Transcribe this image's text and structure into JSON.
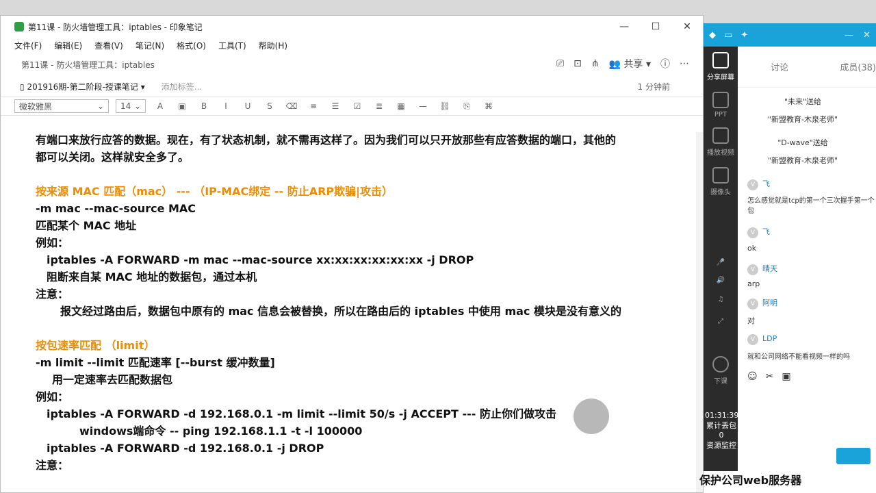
{
  "window": {
    "title": "第11课 - 防火墙管理工具：iptables - 印象笔记",
    "controls": {
      "minimize": "—",
      "maximize": "☐",
      "close": "✕"
    }
  },
  "menu": [
    "文件(F)",
    "编辑(E)",
    "查看(V)",
    "笔记(N)",
    "格式(O)",
    "工具(T)",
    "帮助(H)"
  ],
  "note": {
    "title": "第11课 - 防火墙管理工具：iptables",
    "share_label": "共享",
    "notebook": "201916期-第二阶段-授课笔记",
    "tag_placeholder": "添加标签...",
    "updated": "1 分钟前"
  },
  "toolbar": {
    "font": "微软雅黑",
    "size": "14"
  },
  "content": [
    {
      "text": "有端口来放行应答的数据。现在，有了状态机制，就不需再这样了。因为我们可以只开放那些有应答数据的端口，其他的",
      "cls": ""
    },
    {
      "text": "都可以关闭。这样就安全多了。",
      "cls": ""
    },
    {
      "text": "",
      "cls": ""
    },
    {
      "text": "按来源 MAC 匹配（mac）  ---  （IP-MAC绑定 -- 防止ARP欺骗|攻击）",
      "cls": "orange"
    },
    {
      "text": "-m mac --mac-source MAC",
      "cls": ""
    },
    {
      "text": "匹配某个 MAC 地址",
      "cls": ""
    },
    {
      "text": "例如：",
      "cls": ""
    },
    {
      "text": "iptables -A FORWARD -m mac --mac-source xx:xx:xx:xx:xx:xx -j DROP",
      "cls": "ind1"
    },
    {
      "text": "阻断来自某 MAC 地址的数据包，通过本机",
      "cls": "ind1"
    },
    {
      "text": "注意：",
      "cls": ""
    },
    {
      "text": "报文经过路由后，数据包中原有的 mac 信息会被替换，所以在路由后的 iptables 中使用 mac 模块是没有意义的",
      "cls": "ind3"
    },
    {
      "text": "",
      "cls": ""
    },
    {
      "text": "按包速率匹配    （limit）",
      "cls": "orange"
    },
    {
      "text": "-m limit --limit 匹配速率 [--burst 缓冲数量]",
      "cls": ""
    },
    {
      "text": "用一定速率去匹配数据包",
      "cls": "ind2"
    },
    {
      "text": "例如：",
      "cls": ""
    },
    {
      "text": "iptables -A FORWARD -d 192.168.0.1 -m limit --limit 50/s  -j ACCEPT   ---  防止你们做攻击",
      "cls": "ind1"
    },
    {
      "text": "windows端命令 -- ping 192.168.1.1 -t -l 100000",
      "cls": "ind4"
    },
    {
      "text": "iptables -A FORWARD -d 192.168.0.1 -j DROP",
      "cls": "ind1"
    },
    {
      "text": "注意：",
      "cls": ""
    }
  ],
  "side": {
    "rail": [
      {
        "label": "分享屏幕"
      },
      {
        "label": "PPT"
      },
      {
        "label": "播放视频"
      },
      {
        "label": "摄像头"
      },
      {
        "label": "下课"
      }
    ],
    "tabs": [
      "讨论",
      "成员(38)"
    ],
    "timer": "01:31:39",
    "timer_sub": "累计丢包 0",
    "timer_sub2": "资源监控"
  },
  "chat": [
    {
      "text": "\"未来\"送给",
      "type": "gift"
    },
    {
      "text": "\"新盟教育-木泉老师\"",
      "type": "gift"
    },
    {
      "text": "\"D-wave\"送给",
      "type": "gift"
    },
    {
      "text": "\"新盟教育-木泉老师\"",
      "type": "gift"
    },
    {
      "user": "飞",
      "text": "怎么感觉就是tcp的第一个三次握手第一个包"
    },
    {
      "user": "飞",
      "text": "ok"
    },
    {
      "user": "晴天",
      "text": "arp"
    },
    {
      "user": "阿明",
      "text": "对"
    },
    {
      "user": "LDP",
      "text": "就和公司网络不能看视频一样的吗"
    }
  ],
  "overlay": "保护公司web服务器"
}
